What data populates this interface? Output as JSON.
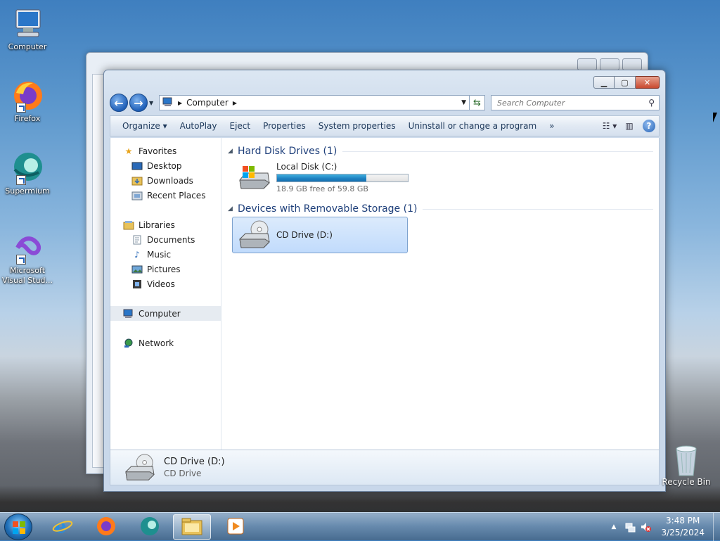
{
  "desktop": {
    "icons": [
      {
        "label": "Computer"
      },
      {
        "label": "Firefox"
      },
      {
        "label": "Supermium"
      },
      {
        "label": "Microsoft Visual Stud..."
      }
    ],
    "recycle_bin": "Recycle Bin"
  },
  "window": {
    "address": {
      "location": "Computer"
    },
    "search": {
      "placeholder": "Search Computer"
    },
    "command_bar": {
      "organize": "Organize",
      "autoplay": "AutoPlay",
      "eject": "Eject",
      "properties": "Properties",
      "system_properties": "System properties",
      "uninstall": "Uninstall or change a program",
      "more": "»"
    },
    "nav": {
      "favorites": "Favorites",
      "desktop": "Desktop",
      "downloads": "Downloads",
      "recent_places": "Recent Places",
      "libraries": "Libraries",
      "documents": "Documents",
      "music": "Music",
      "pictures": "Pictures",
      "videos": "Videos",
      "computer": "Computer",
      "network": "Network"
    },
    "groups": {
      "hard_disk": "Hard Disk Drives (1)",
      "removable": "Devices with Removable Storage (1)"
    },
    "drives": {
      "c": {
        "name": "Local Disk (C:)",
        "free_text": "18.9 GB free of 59.8 GB",
        "used_fraction": 0.684
      },
      "d": {
        "name": "CD Drive (D:)"
      }
    },
    "details": {
      "name": "CD Drive (D:)",
      "type": "CD Drive"
    }
  },
  "taskbar": {
    "time": "3:48 PM",
    "date": "3/25/2024"
  },
  "colors": {
    "accent": "#1f5fb8",
    "selection": "#c1dbfc"
  }
}
